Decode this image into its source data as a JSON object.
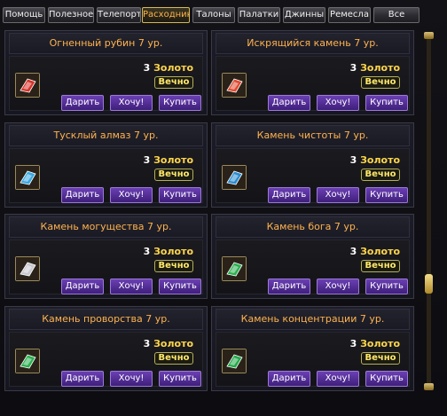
{
  "tabs": [
    {
      "label": "Помощь",
      "active": false
    },
    {
      "label": "Полезное",
      "active": false
    },
    {
      "label": "Телепорт",
      "active": false
    },
    {
      "label": "Расходники",
      "active": true
    },
    {
      "label": "Талоны",
      "active": false
    },
    {
      "label": "Палатки",
      "active": false
    },
    {
      "label": "Джинны",
      "active": false
    },
    {
      "label": "Ремесла",
      "active": false
    },
    {
      "label": "Все",
      "active": false
    }
  ],
  "items": [
    {
      "title": "Огненный рубин 7 ур.",
      "price": "3",
      "currency": "Золото",
      "duration": "Вечно",
      "gem_color": "#d8322a",
      "gift": "Дарить",
      "want": "Хочу!",
      "buy": "Купить"
    },
    {
      "title": "Искрящийся камень 7 ур.",
      "price": "3",
      "currency": "Золото",
      "duration": "Вечно",
      "gem_color": "#e04a30",
      "gift": "Дарить",
      "want": "Хочу!",
      "buy": "Купить"
    },
    {
      "title": "Тусклый алмаз 7 ур.",
      "price": "3",
      "currency": "Золото",
      "duration": "Вечно",
      "gem_color": "#3aa8e0",
      "gift": "Дарить",
      "want": "Хочу!",
      "buy": "Купить"
    },
    {
      "title": "Камень чистоты 7 ур.",
      "price": "3",
      "currency": "Золото",
      "duration": "Вечно",
      "gem_color": "#2a8ad0",
      "gift": "Дарить",
      "want": "Хочу!",
      "buy": "Купить"
    },
    {
      "title": "Камень могущества 7 ур.",
      "price": "3",
      "currency": "Золото",
      "duration": "Вечно",
      "gem_color": "#c8c8d0",
      "gift": "Дарить",
      "want": "Хочу!",
      "buy": "Купить"
    },
    {
      "title": "Камень бога 7 ур.",
      "price": "3",
      "currency": "Золото",
      "duration": "Вечно",
      "gem_color": "#2ab050",
      "gift": "Дарить",
      "want": "Хочу!",
      "buy": "Купить"
    },
    {
      "title": "Камень проворства 7 ур.",
      "price": "3",
      "currency": "Золото",
      "duration": "Вечно",
      "gem_color": "#2ab050",
      "gift": "Дарить",
      "want": "Хочу!",
      "buy": "Купить"
    },
    {
      "title": "Камень концентрации 7 ур.",
      "price": "3",
      "currency": "Золото",
      "duration": "Вечно",
      "gem_color": "#22a848",
      "gift": "Дарить",
      "want": "Хочу!",
      "buy": "Купить"
    }
  ]
}
